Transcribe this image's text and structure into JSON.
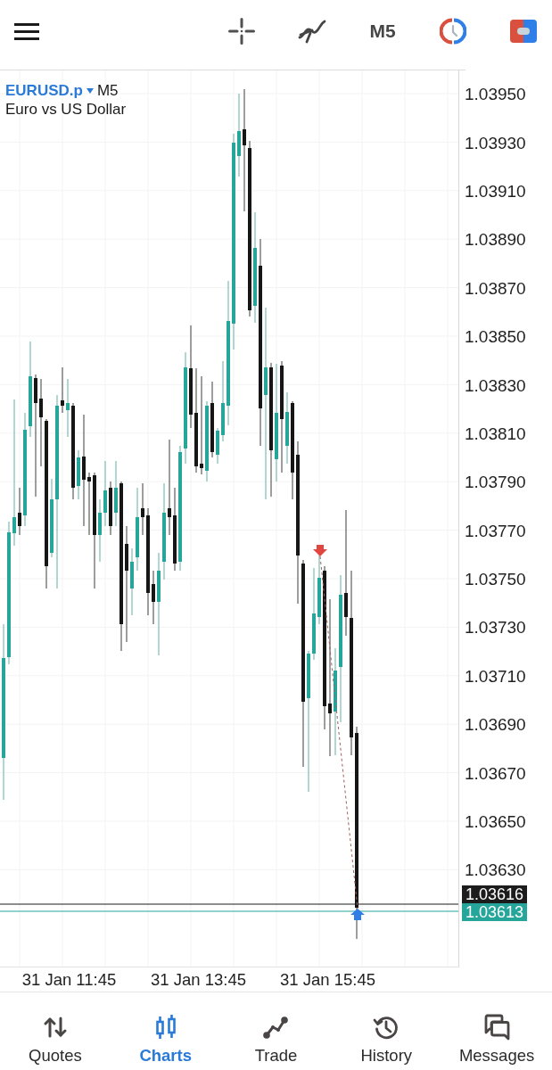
{
  "toolbar": {
    "timeframe": "M5"
  },
  "chart": {
    "symbol": "EURUSD.p",
    "timeframe": "M5",
    "description": "Euro vs US Dollar",
    "price_labels": [
      "1.03950",
      "1.03930",
      "1.03910",
      "1.03890",
      "1.03870",
      "1.03850",
      "1.03830",
      "1.03810",
      "1.03790",
      "1.03770",
      "1.03750",
      "1.03730",
      "1.03710",
      "1.03690",
      "1.03670",
      "1.03650",
      "1.03630"
    ],
    "price_tags": [
      {
        "text": "1.03616",
        "color": "#1c1c1c"
      },
      {
        "text": "1.03613",
        "color": "#26a69a"
      }
    ],
    "time_labels": [
      "31 Jan 11:45",
      "31 Jan 13:45",
      "31 Jan 15:45"
    ]
  },
  "nav": [
    {
      "label": "Quotes",
      "selected": false
    },
    {
      "label": "Charts",
      "selected": true
    },
    {
      "label": "Trade",
      "selected": false
    },
    {
      "label": "History",
      "selected": false
    },
    {
      "label": "Messages",
      "selected": false
    }
  ]
}
